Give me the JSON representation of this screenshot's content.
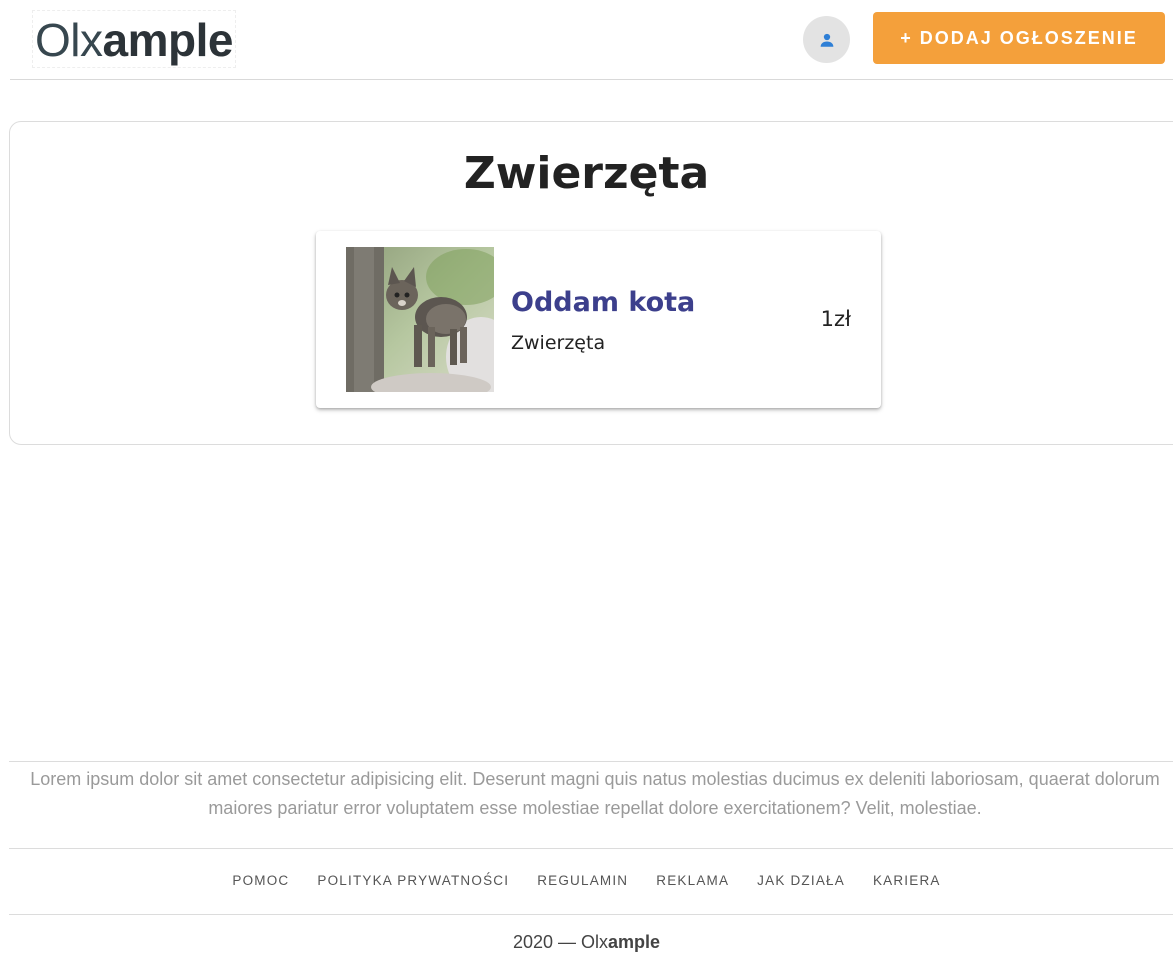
{
  "header": {
    "logo_light": "Olx",
    "logo_bold": "ample",
    "add_button_label": "+ DODAJ OGŁOSZENIE"
  },
  "category": {
    "title": "Zwierzęta"
  },
  "listings": [
    {
      "title": "Oddam kota",
      "category": "Zwierzęta",
      "price": "1zł"
    }
  ],
  "footer": {
    "description": "Lorem ipsum dolor sit amet consectetur adipisicing elit. Deserunt magni quis natus molestias ducimus ex deleniti laboriosam, quaerat dolorum maiores pariatur error voluptatem esse molestiae repellat dolore exercitationem? Velit, molestiae.",
    "links": [
      "POMOC",
      "POLITYKA PRYWATNOŚCI",
      "REGULAMIN",
      "REKLAMA",
      "JAK DZIAŁA",
      "KARIERA"
    ],
    "copyright_prefix": "2020 — ",
    "copyright_light": "Olx",
    "copyright_bold": "ample"
  },
  "colors": {
    "accent": "#f4a03b",
    "listing_title": "#3c3f8c"
  }
}
